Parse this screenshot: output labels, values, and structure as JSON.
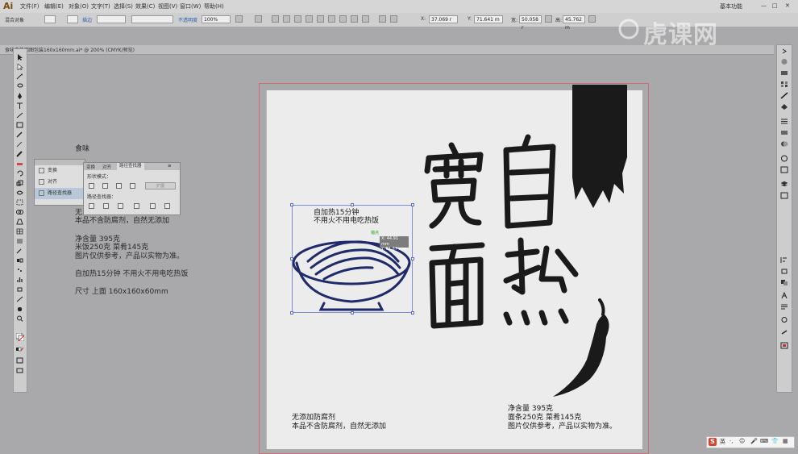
{
  "app": {
    "logo": "Ai",
    "workspace": "基本功能"
  },
  "menu": [
    "文件(F)",
    "编辑(E)",
    "对象(O)",
    "文字(T)",
    "选择(S)",
    "效果(C)",
    "视图(V)",
    "窗口(W)",
    "帮助(H)"
  ],
  "control": {
    "selection_label": "混合对象",
    "opacity_label": "不透明度",
    "opacity": "100%",
    "stroke_link": "描边",
    "x": "37.069 r",
    "y": "71.641 m",
    "w": "50.058 r",
    "h": "45.762 m"
  },
  "document": {
    "tab": "食味自热面图包装160x160mm.ai* @ 200% (CMYK/预览)"
  },
  "small_panel": {
    "items": [
      "变换",
      "对齐",
      "路径查找器"
    ]
  },
  "pathfinder": {
    "tabs": [
      "变换",
      "对齐",
      "路径查找器"
    ],
    "shape_modes": "形状模式：",
    "expand": "扩展",
    "pathfinders": "路径查找器："
  },
  "pasteboard": {
    "line1": "食味",
    "line2": "无",
    "line3": "本品不含防腐剂，自然无添加",
    "line4": "净含量 395克",
    "line5": "米饭250克 菜肴145克",
    "line6": "图片仅供参考，产品以实物为准。",
    "line7": "自加热15分钟 不用火不用电吃热饭",
    "line8": "尺寸 上面 160x160x60mm"
  },
  "artboard": {
    "bowl_l1": "自加热15分钟",
    "bowl_l2": "不用火不用电吃热饭",
    "bl1": "无添加防腐剂",
    "bl2": "本品不含防腐剂，自然无添加",
    "br1": "净含量 395克",
    "br2": "面条250克 菜肴145克",
    "br3": "图片仅供参考，产品以实物为准。"
  },
  "tooltip": {
    "anchor": "锚点",
    "x": "X: 44.91 mm",
    "y": "Y: 61.87 mm"
  },
  "watermark": "虎课网",
  "ime": {
    "items": [
      "英",
      "·,",
      "☺",
      "🎤",
      "⌨",
      "👕",
      "▦"
    ]
  }
}
